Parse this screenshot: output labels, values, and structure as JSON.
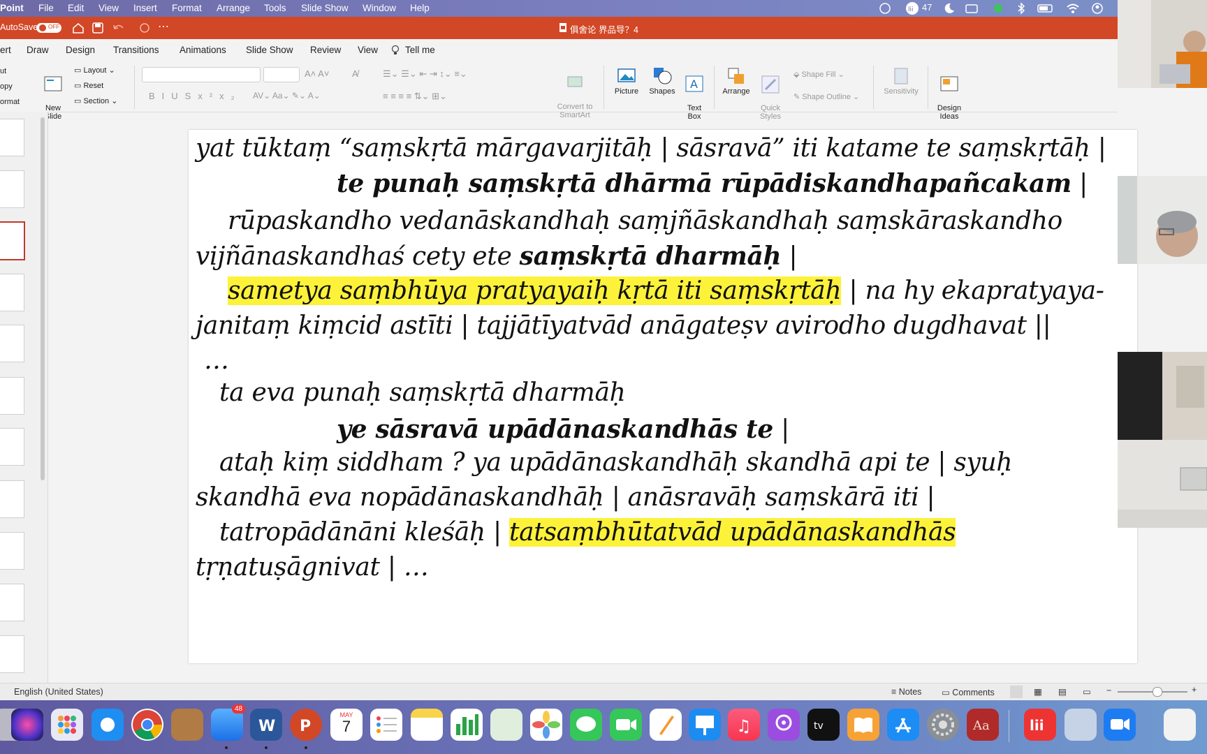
{
  "menubar": {
    "app": "Point",
    "items": [
      "File",
      "Edit",
      "View",
      "Insert",
      "Format",
      "Arrange",
      "Tools",
      "Slide Show",
      "Window",
      "Help"
    ],
    "status_count": "47"
  },
  "titlebar": {
    "autosave_label": "AutoSave",
    "autosave_state": "OFF",
    "doc_title": "俱舍论 界品导？4"
  },
  "tabs": [
    "ert",
    "Draw",
    "Design",
    "Transitions",
    "Animations",
    "Slide Show",
    "Review",
    "View",
    "Tell me"
  ],
  "ribbon": {
    "clip_items": [
      "ut",
      "opy",
      "ormat"
    ],
    "new_slide": "New\nSlide",
    "layout": "Layout",
    "reset": "Reset",
    "section": "Section",
    "convert": "Convert to\nSmartArt",
    "picture": "Picture",
    "shapes": "Shapes",
    "textbox": "Text\nBox",
    "arrange": "Arrange",
    "quick_styles": "Quick\nStyles",
    "shape_fill": "Shape Fill",
    "shape_outline": "Shape Outline",
    "sensitivity": "Sensitivity",
    "design_ideas": "Design\nIdeas"
  },
  "slide_lines": [
    {
      "segments": [
        {
          "t": "yat tūktaṃ “saṃskṛtā mārgavarjitāḥ | sāsravā” iti katame te saṃskṛtāḥ |",
          "b": false,
          "h": false
        }
      ]
    },
    {
      "segments": [
        {
          "t": "te punaḥ saṃskṛtā dhārmā rūpādiskandhapañcakam",
          "b": true,
          "h": false
        },
        {
          "t": " |",
          "b": false,
          "h": false
        }
      ]
    },
    {
      "segments": [
        {
          "t": "rūpaskandho vedanāskandhaḥ saṃjñāskandhaḥ saṃskāraskandho",
          "b": false,
          "h": false
        }
      ]
    },
    {
      "segments": [
        {
          "t": "vijñānaskandhaś cety ete ",
          "b": false,
          "h": false
        },
        {
          "t": "saṃskṛtā dharmāḥ",
          "b": true,
          "h": false
        },
        {
          "t": " |",
          "b": false,
          "h": false
        }
      ]
    },
    {
      "segments": [
        {
          "t": "sametya saṃbhūya pratyayaiḥ kṛtā iti saṃskṛtāḥ",
          "b": false,
          "h": true
        },
        {
          "t": " | na hy ekapratyaya-",
          "b": false,
          "h": false
        }
      ]
    },
    {
      "segments": [
        {
          "t": "janitaṃ kiṃcid astīti | tajjātīyatvād anāgateṣv avirodho dugdhavat ||",
          "b": false,
          "h": false
        }
      ]
    },
    {
      "segments": [
        {
          "t": "…",
          "b": false,
          "h": false
        }
      ]
    },
    {
      "segments": [
        {
          "t": "ta eva punaḥ saṃskṛtā dharmāḥ",
          "b": false,
          "h": false
        }
      ]
    },
    {
      "segments": [
        {
          "t": "ye sāsravā upādānaskandhās te",
          "b": true,
          "h": false
        },
        {
          "t": " |",
          "b": false,
          "h": false
        }
      ]
    },
    {
      "segments": [
        {
          "t": "ataḥ kiṃ siddham ? ya upādānaskandhāḥ skandhā api te | syuḥ",
          "b": false,
          "h": false
        }
      ]
    },
    {
      "segments": [
        {
          "t": "skandhā eva nopādānaskandhāḥ | anāsravāḥ saṃskārā iti |",
          "b": false,
          "h": false
        }
      ]
    },
    {
      "segments": [
        {
          "t": "tatropādānāni kleśāḥ | ",
          "b": false,
          "h": false
        },
        {
          "t": "tatsaṃbhūtatvād upādānaskandhās",
          "b": false,
          "h": true
        }
      ]
    },
    {
      "segments": [
        {
          "t": "tṛṇatuṣāgnivat | …",
          "b": false,
          "h": false
        }
      ]
    }
  ],
  "status": {
    "language": "English (United States)",
    "notes": "Notes",
    "comments": "Comments"
  },
  "dock": {
    "mail_badge": "48",
    "calendar_month": "MAY",
    "calendar_day": "7"
  },
  "colors": {
    "titlebar": "#d24726",
    "highlight": "#fdf23a"
  }
}
